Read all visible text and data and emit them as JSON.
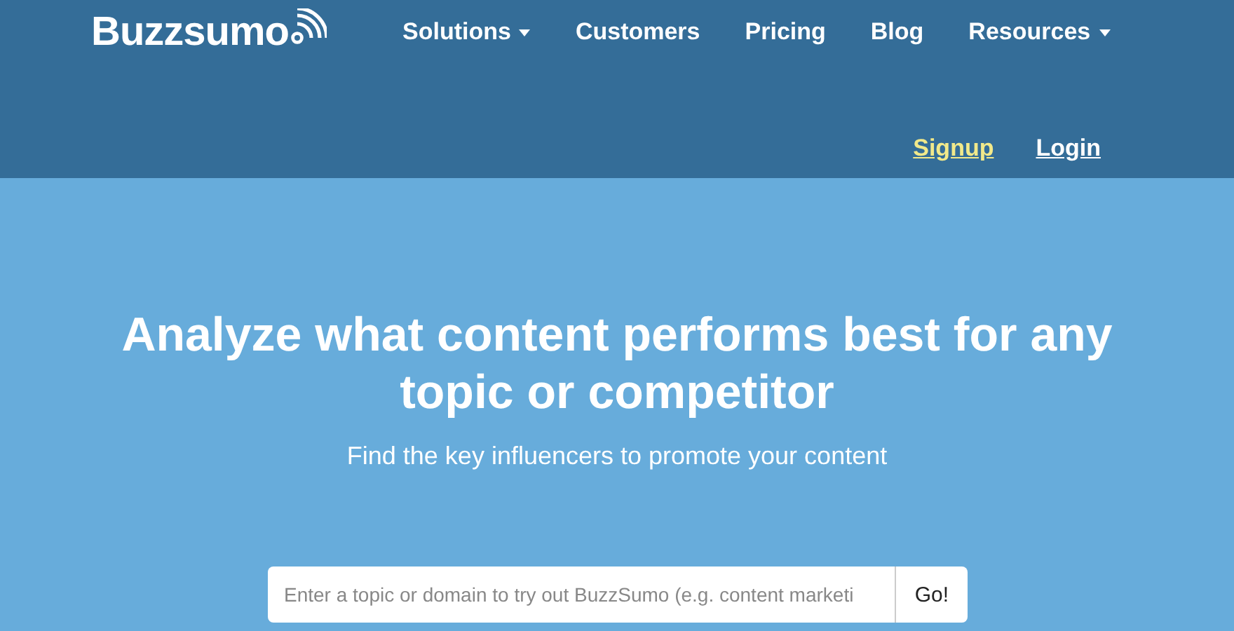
{
  "header": {
    "logo": "Buzzsumo",
    "nav": [
      {
        "label": "Solutions",
        "dropdown": true
      },
      {
        "label": "Customers",
        "dropdown": false
      },
      {
        "label": "Pricing",
        "dropdown": false
      },
      {
        "label": "Blog",
        "dropdown": false
      },
      {
        "label": "Resources",
        "dropdown": true
      }
    ],
    "account_links": [
      {
        "label": "Signup",
        "highlighted": true
      },
      {
        "label": "Login",
        "highlighted": false
      }
    ]
  },
  "hero": {
    "headline": "Analyze what content performs best for any topic or competitor",
    "subtitle": "Find the key influencers to promote your content",
    "search": {
      "placeholder": "Enter a topic or domain to try out BuzzSumo (e.g. content marketi",
      "button": "Go!"
    }
  }
}
